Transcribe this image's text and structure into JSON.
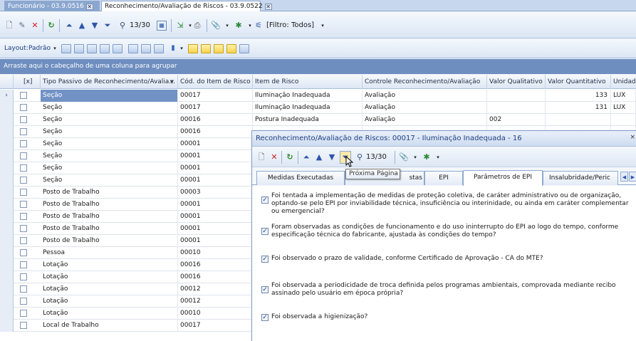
{
  "doc_tabs": [
    {
      "label": "Funcionário - 03.9.0516"
    },
    {
      "label": "Reconhecimento/Avaliação de Riscos - 03.9.0522"
    }
  ],
  "toolbar": {
    "record_position": "13/30",
    "filter_label": "[Filtro: Todos]"
  },
  "layout_bar": {
    "layout_label": "Layout:",
    "layout_value": "Padrão"
  },
  "group_hint": "Arraste aqui o cabeçalho de uma coluna para agrupar",
  "grid": {
    "columns": [
      "[x]",
      "Tipo Passivo de Reconhecimento/Avalia...",
      "Cód. do Item de Risco",
      "Item de Risco",
      "Controle Reconhecimento/Avaliação",
      "Valor Qualitativo",
      "Valor Quantitativo",
      "Unidad"
    ],
    "rows": [
      {
        "tipo": "Seção",
        "cod": "00017",
        "item": "Iluminação Inadequada",
        "controle": "Avaliação",
        "qual": "",
        "quant": "133",
        "unid": "LUX"
      },
      {
        "tipo": "Seção",
        "cod": "00017",
        "item": "Iluminação Inadequada",
        "controle": "Avaliação",
        "qual": "",
        "quant": "131",
        "unid": "LUX"
      },
      {
        "tipo": "Seção",
        "cod": "00016",
        "item": "Postura Inadequada",
        "controle": "Avaliação",
        "qual": "002",
        "quant": "",
        "unid": ""
      },
      {
        "tipo": "Seção",
        "cod": "00016",
        "item": "",
        "controle": "",
        "qual": "",
        "quant": "",
        "unid": ""
      },
      {
        "tipo": "Seção",
        "cod": "00001",
        "item": "",
        "controle": "",
        "qual": "",
        "quant": "",
        "unid": ""
      },
      {
        "tipo": "Seção",
        "cod": "00001",
        "item": "",
        "controle": "",
        "qual": "",
        "quant": "",
        "unid": ""
      },
      {
        "tipo": "Seção",
        "cod": "00001",
        "item": "",
        "controle": "",
        "qual": "",
        "quant": "",
        "unid": ""
      },
      {
        "tipo": "Seção",
        "cod": "00001",
        "item": "",
        "controle": "",
        "qual": "",
        "quant": "",
        "unid": ""
      },
      {
        "tipo": "Posto de Trabalho",
        "cod": "00003",
        "item": "",
        "controle": "",
        "qual": "",
        "quant": "",
        "unid": ""
      },
      {
        "tipo": "Posto de Trabalho",
        "cod": "00001",
        "item": "",
        "controle": "",
        "qual": "",
        "quant": "",
        "unid": ""
      },
      {
        "tipo": "Posto de Trabalho",
        "cod": "00001",
        "item": "",
        "controle": "",
        "qual": "",
        "quant": "",
        "unid": ""
      },
      {
        "tipo": "Posto de Trabalho",
        "cod": "00001",
        "item": "",
        "controle": "",
        "qual": "",
        "quant": "",
        "unid": ""
      },
      {
        "tipo": "Posto de Trabalho",
        "cod": "00001",
        "item": "",
        "controle": "",
        "qual": "",
        "quant": "",
        "unid": ""
      },
      {
        "tipo": "Pessoa",
        "cod": "00010",
        "item": "",
        "controle": "",
        "qual": "",
        "quant": "",
        "unid": ""
      },
      {
        "tipo": "Lotação",
        "cod": "00016",
        "item": "",
        "controle": "",
        "qual": "",
        "quant": "",
        "unid": ""
      },
      {
        "tipo": "Lotação",
        "cod": "00016",
        "item": "",
        "controle": "",
        "qual": "",
        "quant": "",
        "unid": ""
      },
      {
        "tipo": "Lotação",
        "cod": "00012",
        "item": "",
        "controle": "",
        "qual": "",
        "quant": "",
        "unid": ""
      },
      {
        "tipo": "Lotação",
        "cod": "00012",
        "item": "",
        "controle": "",
        "qual": "",
        "quant": "",
        "unid": ""
      },
      {
        "tipo": "Lotação",
        "cod": "00010",
        "item": "",
        "controle": "",
        "qual": "",
        "quant": "",
        "unid": ""
      },
      {
        "tipo": "Local de Trabalho",
        "cod": "00017",
        "item": "",
        "controle": "",
        "qual": "",
        "quant": "",
        "unid": ""
      }
    ]
  },
  "popup": {
    "title": "Reconhecimento/Avaliação de Riscos: 00017 - Iluminação Inadequada - 16",
    "record_position": "13/30",
    "tabs": [
      "Medidas Executadas",
      "stas",
      "EPI",
      "Parâmetros de EPI",
      "Insalubridade/Peric"
    ],
    "questions": [
      {
        "text": "Foi tentada a implementação de medidas de proteção coletiva, de caráter administrativo ou de organização, optando-se pelo EPI por inviabilidade técnica, insuficiência ou interinidade, ou ainda em caráter complementar ou emergencial?",
        "checked": true
      },
      {
        "text": "Foram observadas as condições de funcionamento e do uso ininterrupto do EPI ao logo do tempo, conforme especificação técnica do fabricante, ajustada às condições do tempo?",
        "checked": true
      },
      {
        "text": "Foi observado o prazo de validade, conforme Certificado de Aprovação - CA do MTE?",
        "checked": true
      },
      {
        "text": "Foi observada a periodicidade de troca definida pelos programas ambientais, comprovada mediante recibo assinado pelo usuário em época própria?",
        "checked": true
      },
      {
        "text": "Foi observada a higienização?",
        "checked": true
      }
    ]
  },
  "tooltip": "Próxima Página",
  "colors": {
    "selection": "#7292c6",
    "groupbar": "#6e8ec0",
    "popup_title": "#1f3f82"
  }
}
